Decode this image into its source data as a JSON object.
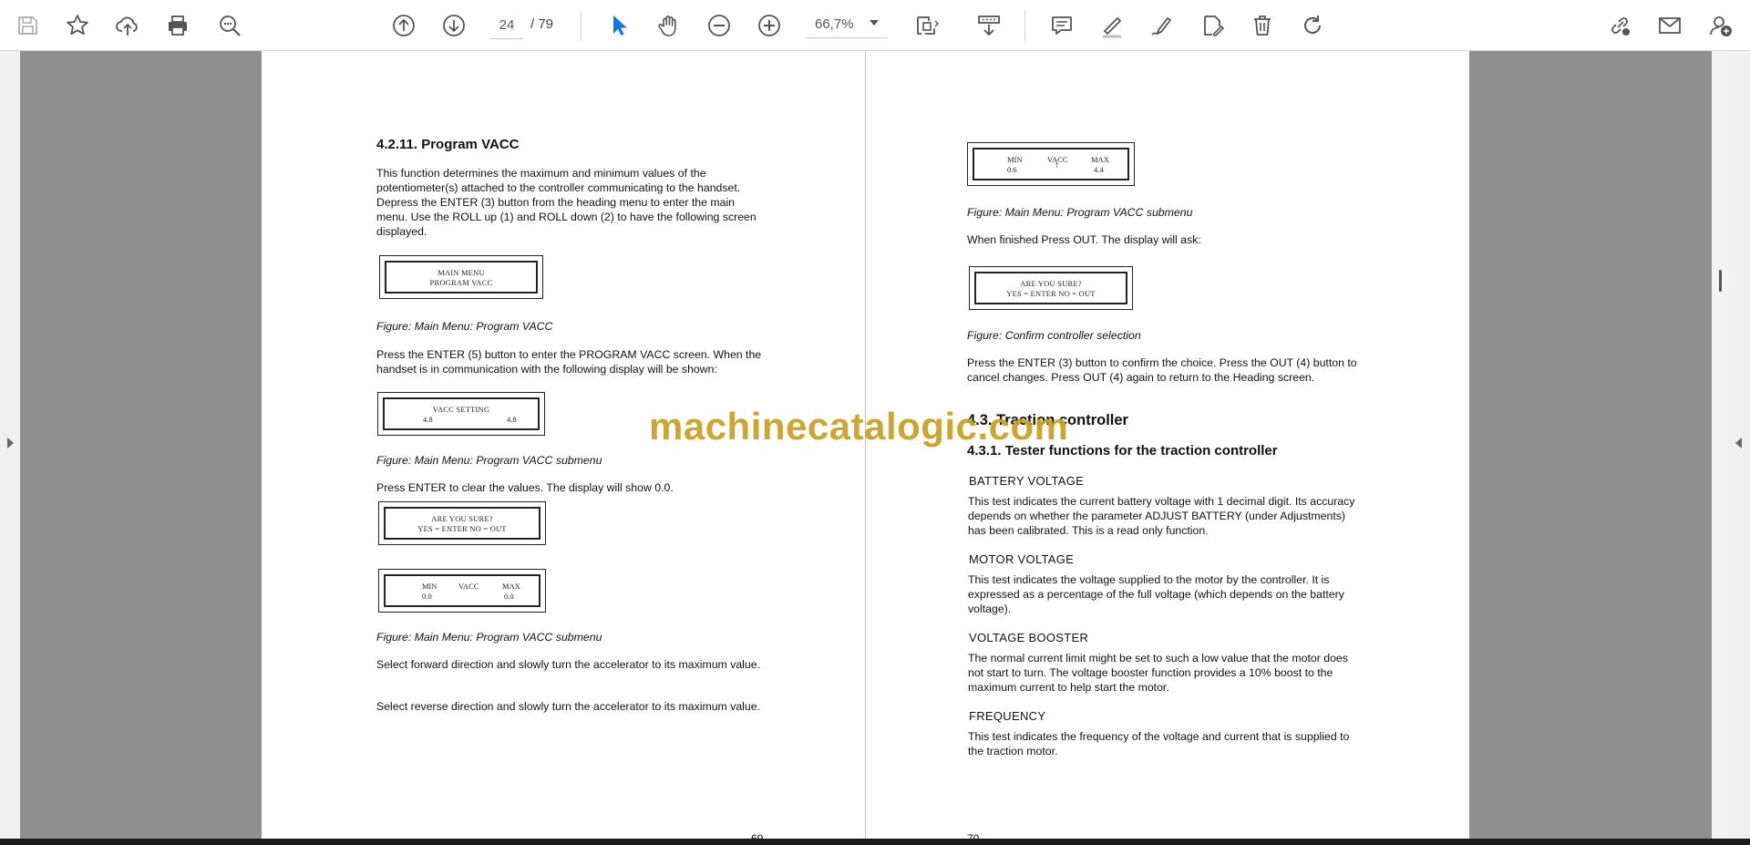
{
  "toolbar": {
    "page_current": "24",
    "page_total": "/ 79",
    "zoom": "66,7%",
    "icons": [
      "save-icon",
      "bookmark-star-icon",
      "upload-cloud-icon",
      "print-icon",
      "zoom-search-icon",
      "page-up-icon",
      "page-down-icon",
      "select-cursor-icon",
      "hand-tool-icon",
      "zoom-out-icon",
      "zoom-in-icon",
      "fit-page-icon",
      "scroll-mode-icon",
      "comment-icon",
      "highlight-pen-icon",
      "draw-icon",
      "edit-document-icon",
      "delete-icon",
      "rotate-icon",
      "share-link-icon",
      "email-icon",
      "add-user-icon"
    ],
    "accent": "#1473e6"
  },
  "left_page": {
    "heading": "4.2.11. Program VACC",
    "intro": "This function determines the maximum and minimum values of the potentiometer(s) attached to the controller communicating to the handset. Depress the ENTER (3) button from the heading menu to enter the main menu. Use the ROLL up (1) and ROLL down (2) to have the following screen displayed.",
    "lcd1": {
      "line1": "MAIN MENU",
      "line2": "PROGRAM VACC"
    },
    "caption1": "Figure: Main Menu: Program VACC",
    "para2": "Press the ENTER (5) button to enter the PROGRAM VACC screen. When the handset is in communication with the following display will be shown:",
    "lcd2": {
      "line1": "VACC SETTING",
      "left": "4.8",
      "right": "4.8"
    },
    "caption2": "Figure: Main Menu: Program VACC submenu",
    "para3": "Press ENTER to clear the values. The display will show 0.0.",
    "lcd3": {
      "line1": "ARE YOU SURE?",
      "line2": "YES = ENTER  NO = OUT"
    },
    "lcd4": {
      "min": "MIN",
      "vacc": "VACC",
      "max": "MAX",
      "min_val": "0.0",
      "max_val": "0.0"
    },
    "caption3": "Figure: Main Menu: Program VACC submenu",
    "para4": "Select forward direction and slowly turn the accelerator to its maximum value.",
    "para5": "Select reverse direction and slowly turn the accelerator to its maximum value.",
    "page_number": "69"
  },
  "right_page": {
    "lcd1": {
      "min": "MIN",
      "vacc": "VACC",
      "max": "MAX",
      "min_val": "0.6",
      "max_val": "4.4"
    },
    "caption1": "Figure: Main Menu: Program VACC submenu",
    "para1": "When finished Press OUT. The display will ask:",
    "lcd2": {
      "line1": "ARE YOU SURE?",
      "line2": "YES = ENTER  NO = OUT"
    },
    "caption2": "Figure: Confirm controller selection",
    "para2": "Press the ENTER (3) button to confirm the choice. Press the OUT (4) button to cancel changes. Press OUT (4) again to return to the Heading screen.",
    "heading_main": "4.3. Traction controller",
    "heading_sub": "4.3.1. Tester functions for the traction controller",
    "sections": [
      {
        "title": "BATTERY VOLTAGE",
        "text": "This test indicates the current battery voltage with 1 decimal digit. Its accuracy depends on whether the parameter ADJUST BATTERY (under Adjustments) has been calibrated. This is a read only function."
      },
      {
        "title": "MOTOR VOLTAGE",
        "text": "This test indicates the voltage supplied to the motor by the controller. It is expressed as a percentage of the full voltage (which depends on the battery voltage)."
      },
      {
        "title": "VOLTAGE BOOSTER",
        "text": "The normal current limit might be set to such a low value that the motor does not start to turn. The voltage booster function provides a 10% boost to the maximum current to help start the motor."
      },
      {
        "title": "FREQUENCY",
        "text": "This test indicates the frequency of the voltage and current that is supplied to the traction motor."
      }
    ],
    "page_number": "70"
  },
  "watermark": "machinecatalogic.com"
}
